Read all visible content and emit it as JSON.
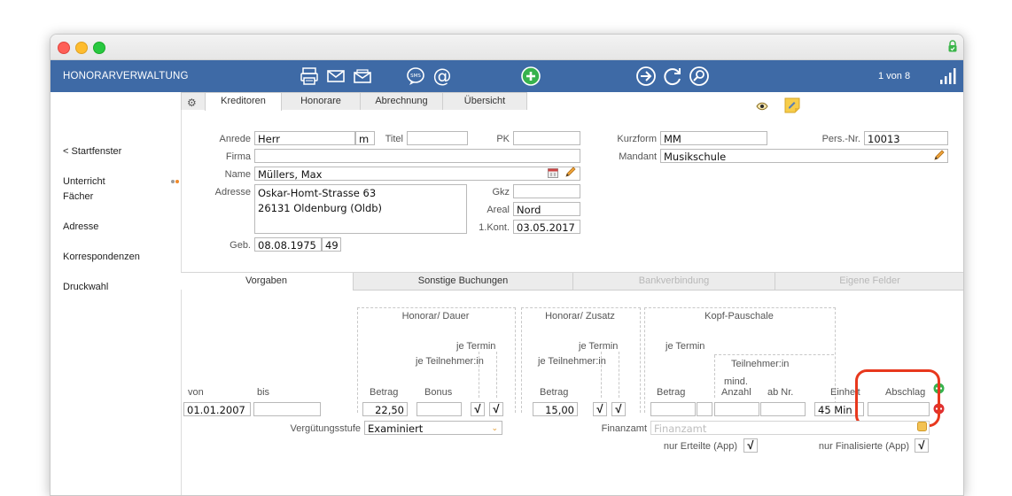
{
  "toolbar": {
    "title": "HONORARVERWALTUNG",
    "record_counter": "1 von 8",
    "icons": [
      "printer-icon",
      "mail-icon",
      "open-mail-icon",
      "sms-icon",
      "at-icon",
      "add-icon",
      "forward-icon",
      "refresh-icon",
      "search-icon",
      "signal-icon"
    ]
  },
  "sidebar": {
    "items": [
      {
        "label": "< Startfenster"
      },
      {
        "label": "Unterricht"
      },
      {
        "label": "Fächer"
      },
      {
        "label": "Adresse"
      },
      {
        "label": "Korrespondenzen"
      },
      {
        "label": "Druckwahl"
      }
    ]
  },
  "tabs_top": [
    "Kreditoren",
    "Honorare",
    "Abrechnung",
    "Übersicht"
  ],
  "person": {
    "anrede_label": "Anrede",
    "anrede": "Herr",
    "gender": "m",
    "titel_label": "Titel",
    "titel": "",
    "pk_label": "PK",
    "pk": "",
    "firma_label": "Firma",
    "firma": "",
    "name_label": "Name",
    "name": "Müllers, Max",
    "adresse_label": "Adresse",
    "adresse": "Oskar-Homt-Strasse 63\n26131 Oldenburg (Oldb)",
    "gkz_label": "Gkz",
    "gkz": "",
    "areal_label": "Areal",
    "areal": "Nord",
    "kont_label": "1.Kont.",
    "kont": "03.05.2017",
    "geb_label": "Geb.",
    "geb": "08.08.1975",
    "alter": "49",
    "kurzform_label": "Kurzform",
    "kurzform": "MM",
    "persnr_label": "Pers.-Nr.",
    "persnr": "10013",
    "mandant_label": "Mandant",
    "mandant": "Musikschule"
  },
  "tabs_bottom": [
    {
      "label": "Vorgaben",
      "state": "active"
    },
    {
      "label": "Sonstige Buchungen",
      "state": "normal"
    },
    {
      "label": "Bankverbindung",
      "state": "disabled"
    },
    {
      "label": "Eigene Felder",
      "state": "disabled"
    }
  ],
  "vorgaben": {
    "group_dauer": "Honorar/ Dauer",
    "group_zusatz": "Honorar/ Zusatz",
    "group_kopf": "Kopf-Pauschale",
    "je_termin": "je Termin",
    "je_teilnehmer": "je Teilnehmer:in",
    "teilnehmer": "Teilnehmer:in",
    "col_von": "von",
    "col_bis": "bis",
    "col_betrag": "Betrag",
    "col_bonus": "Bonus",
    "col_mind_1": "mind.",
    "col_mind_2": "Anzahl",
    "col_abnr": "ab Nr.",
    "col_einheit": "Einheit",
    "col_abschlag": "Abschlag",
    "von": "01.01.2007",
    "bis": "",
    "betrag_dauer": "22,50",
    "bonus": "",
    "betrag_zusatz": "15,00",
    "einheit": "45 Min",
    "abschlag": "",
    "check_mark": "√",
    "verguetung_label": "Vergütungsstufe",
    "verguetung": "Examiniert",
    "finanzamt_label": "Finanzamt",
    "finanzamt_placeholder": "Finanzamt",
    "nur_erteilte": "nur Erteilte (App)",
    "nur_finalisierte": "nur Finalisierte (App)"
  },
  "colors": {
    "toolbar": "#3e6aa6",
    "highlight": "#e8381d",
    "add": "#37b24d",
    "remove": "#e03030"
  }
}
